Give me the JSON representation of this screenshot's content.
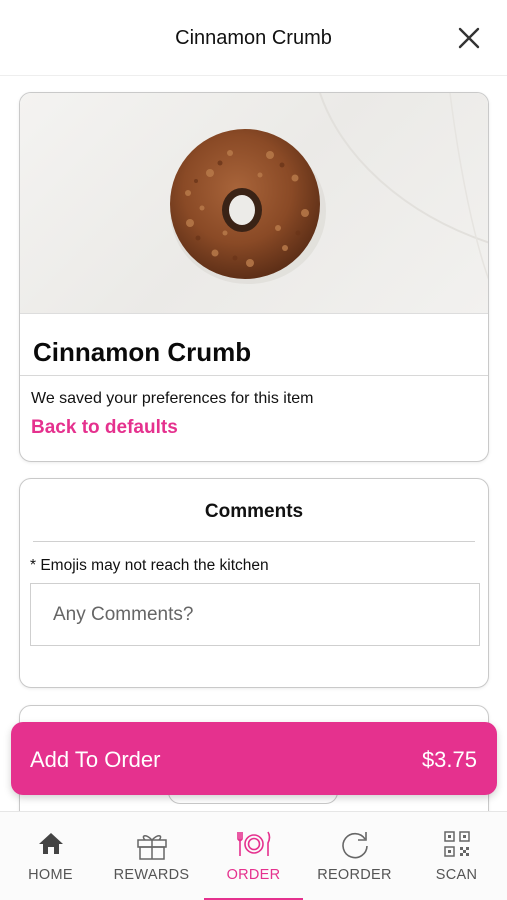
{
  "header": {
    "title": "Cinnamon Crumb"
  },
  "item": {
    "name": "Cinnamon Crumb",
    "saved_text": "We saved your preferences for this item",
    "back_link": "Back to defaults"
  },
  "comments": {
    "title": "Comments",
    "note": "* Emojis may not reach the kitchen",
    "placeholder": "Any Comments?",
    "value": ""
  },
  "add_to_order": {
    "label": "Add To Order",
    "price": "$3.75"
  },
  "tabs": [
    {
      "label": "HOME",
      "icon": "home-icon",
      "active": false
    },
    {
      "label": "REWARDS",
      "icon": "gift-icon",
      "active": false
    },
    {
      "label": "ORDER",
      "icon": "plate-utensils-icon",
      "active": true
    },
    {
      "label": "REORDER",
      "icon": "refresh-icon",
      "active": false
    },
    {
      "label": "SCAN",
      "icon": "qr-code-icon",
      "active": false
    }
  ],
  "colors": {
    "accent": "#e5318e",
    "text": "#111111",
    "border": "#c9c9c9"
  }
}
